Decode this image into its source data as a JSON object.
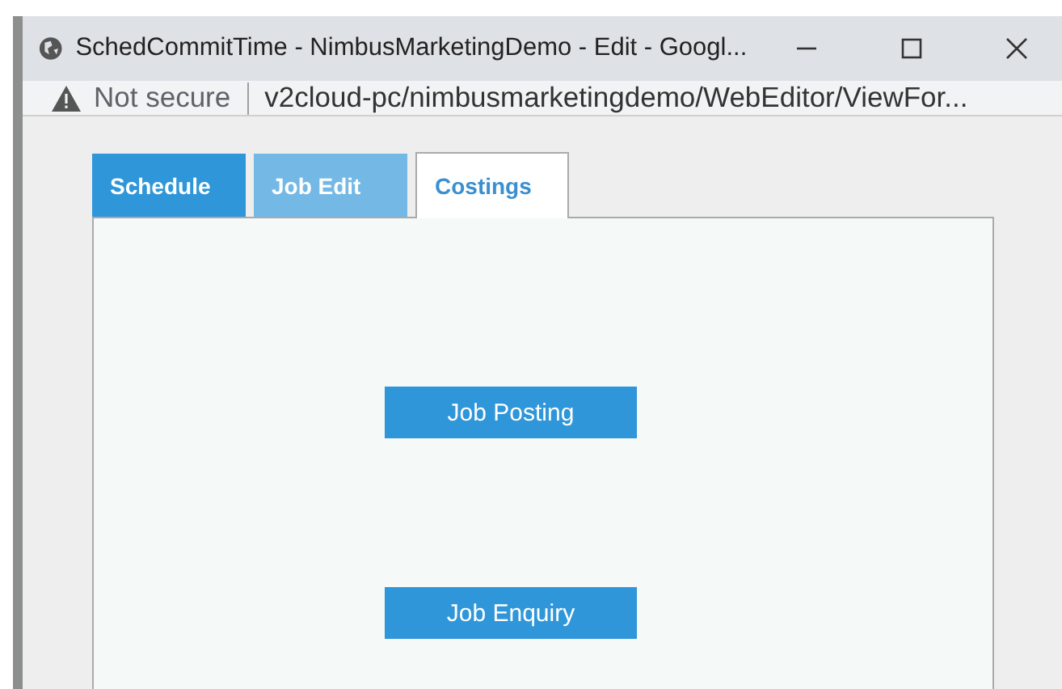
{
  "window": {
    "title": "SchedCommitTime - NimbusMarketingDemo - Edit - Googl..."
  },
  "address_bar": {
    "security": "Not secure",
    "url": "v2cloud-pc/nimbusmarketingdemo/WebEditor/ViewFor..."
  },
  "tabs": [
    {
      "label": "Schedule",
      "selected": false,
      "color": "#2f96d9"
    },
    {
      "label": "Job Edit",
      "selected": false,
      "color": "#74b9e6"
    },
    {
      "label": "Costings",
      "selected": true,
      "color": "#ffffff"
    }
  ],
  "buttons": [
    "Job Posting",
    "Job Enquiry"
  ]
}
